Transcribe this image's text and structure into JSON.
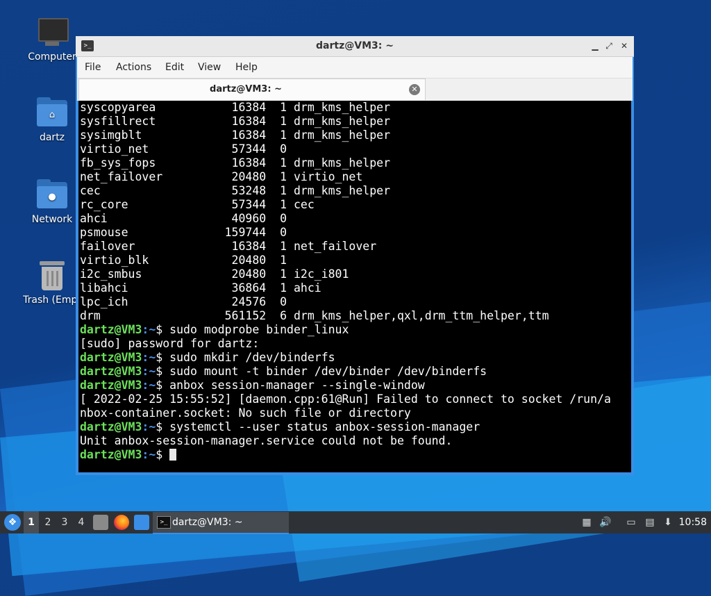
{
  "desktop": {
    "icons": [
      {
        "label": "Computer"
      },
      {
        "label": "dartz"
      },
      {
        "label": "Network"
      },
      {
        "label": "Trash (Empt"
      }
    ]
  },
  "window": {
    "title": "dartz@VM3: ~",
    "menu": [
      "File",
      "Actions",
      "Edit",
      "View",
      "Help"
    ],
    "tab_label": "dartz@VM3: ~",
    "prompt_user": "dartz@VM3",
    "prompt_path": ":~",
    "lines": [
      {
        "kind": "text",
        "text": "syscopyarea           16384  1 drm_kms_helper"
      },
      {
        "kind": "text",
        "text": "sysfillrect           16384  1 drm_kms_helper"
      },
      {
        "kind": "text",
        "text": "sysimgblt             16384  1 drm_kms_helper"
      },
      {
        "kind": "text",
        "text": "virtio_net            57344  0"
      },
      {
        "kind": "text",
        "text": "fb_sys_fops           16384  1 drm_kms_helper"
      },
      {
        "kind": "text",
        "text": "net_failover          20480  1 virtio_net"
      },
      {
        "kind": "text",
        "text": "cec                   53248  1 drm_kms_helper"
      },
      {
        "kind": "text",
        "text": "rc_core               57344  1 cec"
      },
      {
        "kind": "text",
        "text": "ahci                  40960  0"
      },
      {
        "kind": "text",
        "text": "psmouse              159744  0"
      },
      {
        "kind": "text",
        "text": "failover              16384  1 net_failover"
      },
      {
        "kind": "text",
        "text": "virtio_blk            20480  1"
      },
      {
        "kind": "text",
        "text": "i2c_smbus             20480  1 i2c_i801"
      },
      {
        "kind": "text",
        "text": "libahci               36864  1 ahci"
      },
      {
        "kind": "text",
        "text": "lpc_ich               24576  0"
      },
      {
        "kind": "text",
        "text": "drm                  561152  6 drm_kms_helper,qxl,drm_ttm_helper,ttm"
      },
      {
        "kind": "cmd",
        "text": "$ sudo modprobe binder_linux"
      },
      {
        "kind": "text",
        "text": "[sudo] password for dartz:"
      },
      {
        "kind": "cmd",
        "text": "$ sudo mkdir /dev/binderfs"
      },
      {
        "kind": "cmd",
        "text": "$ sudo mount -t binder /dev/binder /dev/binderfs"
      },
      {
        "kind": "cmd",
        "text": "$ anbox session-manager --single-window"
      },
      {
        "kind": "text",
        "text": "[ 2022-02-25 15:55:52] [daemon.cpp:61@Run] Failed to connect to socket /run/a"
      },
      {
        "kind": "text",
        "text": "nbox-container.socket: No such file or directory"
      },
      {
        "kind": "cmd",
        "text": "$ systemctl --user status anbox-session-manager"
      },
      {
        "kind": "text",
        "text": "Unit anbox-session-manager.service could not be found."
      },
      {
        "kind": "cmd",
        "text": "$ ",
        "cursor": true
      }
    ]
  },
  "taskbar": {
    "workspaces": [
      "1",
      "2",
      "3",
      "4"
    ],
    "active_workspace": "1",
    "task_label": "dartz@VM3: ~",
    "clock": "10:58"
  },
  "colors": {
    "prompt_user": "#6ce05a",
    "prompt_path": "#4f8fe8",
    "accent": "#3a8ee6"
  }
}
